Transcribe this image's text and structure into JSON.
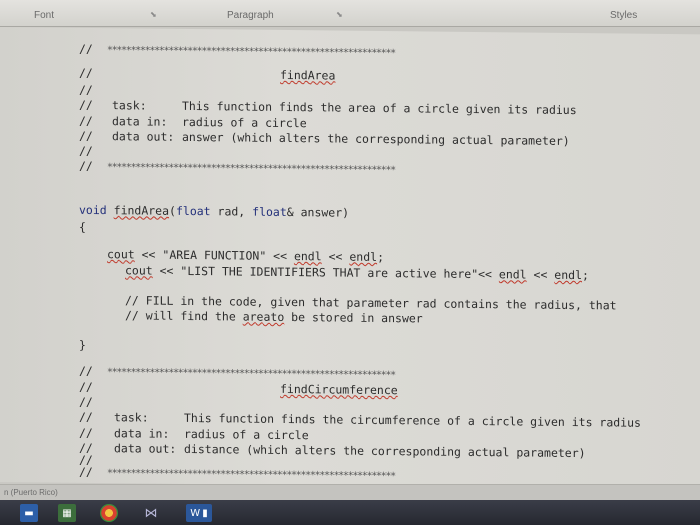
{
  "ribbon": {
    "font_label": "Font",
    "paragraph_label": "Paragraph",
    "styles_label": "Styles"
  },
  "code": {
    "find_area_header": {
      "comment": "//",
      "stars": "*************************************************************",
      "name": "findArea",
      "task_label": "task:",
      "task_text": "This function finds the area of a circle given its radius",
      "data_in_label": "data in:",
      "data_in_text": "radius of a circle",
      "data_out_label": "data out:",
      "data_out_text": "answer (which alters the corresponding actual parameter)"
    },
    "signature": {
      "void": "void",
      "func": "findArea",
      "open_paren": "(",
      "float1": "float",
      "param1": " rad, ",
      "float2": "float",
      "param2": "& answer)"
    },
    "open_brace": "{",
    "close_brace": "}",
    "cout1": {
      "cout": "cout",
      "rest1": " << \"AREA FUNCTION\" << ",
      "endl1": "endl",
      "rest2": " << ",
      "endl2": "endl",
      "end": ";"
    },
    "cout2": {
      "cout": "cout",
      "rest1": " << \"LIST THE IDENTIFIERS THAT are active here\"<< ",
      "endl1": "endl",
      "rest2": " << ",
      "endl2": "endl",
      "end": ";"
    },
    "fill_comment1": "// FILL in the code, given that parameter rad contains the radius, that",
    "fill_comment2_a": "// will find the ",
    "fill_comment2_b": "areato",
    "fill_comment2_c": " be stored in answer",
    "find_circ_header": {
      "comment": "//",
      "stars": "*************************************************************",
      "name": "findCircumference",
      "task_label": "task:",
      "task_text": "This function finds the circumference of a circle given its radius",
      "data_in_label": "data in:",
      "data_in_text": "radius of a circle",
      "data_out_label": "data out:",
      "data_out_text": "distance (which alters the corresponding actual parameter)"
    }
  },
  "status": {
    "language": "n (Puerto Rico)"
  },
  "taskbar": {
    "word_label": "W"
  }
}
